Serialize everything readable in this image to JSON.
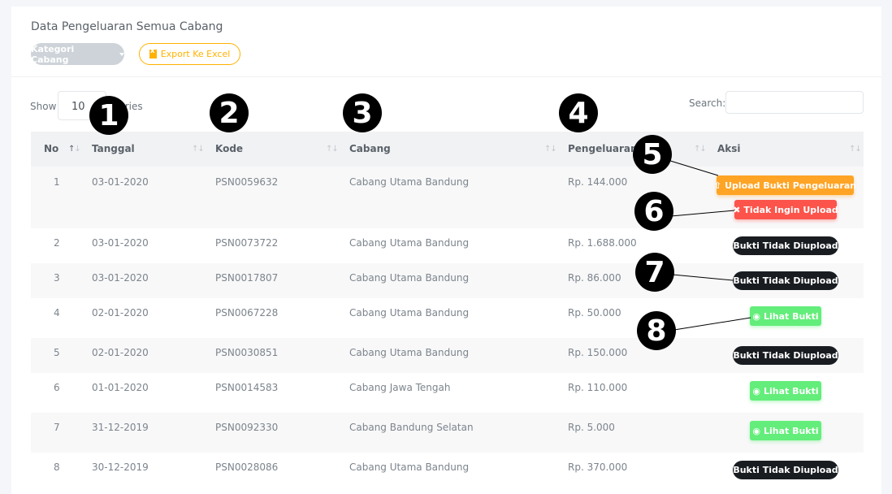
{
  "card": {
    "title": "Data Pengeluaran Semua Cabang",
    "kategori_label": "Kategori Cabang",
    "export_label": "Export Ke Excel"
  },
  "controls": {
    "show_label": "Show",
    "entries_value": "10",
    "entries_label": "entries",
    "search_label": "Search:"
  },
  "table": {
    "headers": [
      "No",
      "Tanggal",
      "Kode",
      "Cabang",
      "Pengeluaran",
      "Aksi"
    ],
    "rows": [
      {
        "no": "1",
        "tanggal": "03-01-2020",
        "kode": "PSN0059632",
        "cabang": "Cabang Utama Bandung",
        "pengeluaran": "Rp. 144.000"
      },
      {
        "no": "2",
        "tanggal": "03-01-2020",
        "kode": "PSN0073722",
        "cabang": "Cabang Utama Bandung",
        "pengeluaran": "Rp. 1.688.000"
      },
      {
        "no": "3",
        "tanggal": "03-01-2020",
        "kode": "PSN0017807",
        "cabang": "Cabang Utama Bandung",
        "pengeluaran": "Rp. 86.000"
      },
      {
        "no": "4",
        "tanggal": "02-01-2020",
        "kode": "PSN0067228",
        "cabang": "Cabang Utama Bandung",
        "pengeluaran": "Rp. 50.000"
      },
      {
        "no": "5",
        "tanggal": "02-01-2020",
        "kode": "PSN0030851",
        "cabang": "Cabang Utama Bandung",
        "pengeluaran": "Rp. 150.000"
      },
      {
        "no": "6",
        "tanggal": "01-01-2020",
        "kode": "PSN0014583",
        "cabang": "Cabang Jawa Tengah",
        "pengeluaran": "Rp. 110.000"
      },
      {
        "no": "7",
        "tanggal": "31-12-2019",
        "kode": "PSN0092330",
        "cabang": "Cabang Bandung Selatan",
        "pengeluaran": "Rp. 5.000"
      },
      {
        "no": "8",
        "tanggal": "30-12-2019",
        "kode": "PSN0028086",
        "cabang": "Cabang Utama Bandung",
        "pengeluaran": "Rp. 370.000"
      }
    ]
  },
  "actions": {
    "upload": "Upload Bukti Pengeluaran",
    "tidak_upload": "Tidak Ingin Upload",
    "bukti_tidak": "Bukti Tidak Diupload",
    "lihat": "Lihat Bukti"
  },
  "callouts": [
    "1",
    "2",
    "3",
    "4",
    "5",
    "6",
    "7",
    "8"
  ],
  "colors": {
    "upload": "#ffa425",
    "tidak_upload": "#fc544b",
    "lihat": "#63ed7a",
    "dark_badge": "#191d21",
    "export": "#ffb200"
  }
}
